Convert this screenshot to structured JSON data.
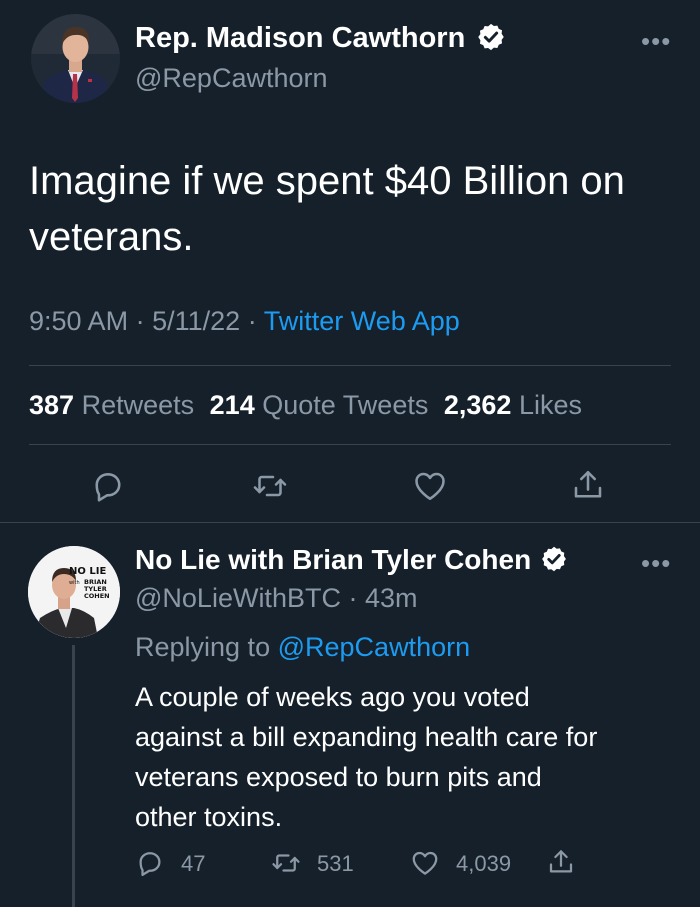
{
  "main_tweet": {
    "author_name": "Rep. Madison Cawthorn",
    "author_handle": "@RepCawthorn",
    "text_line1": "Imagine if we spent $40 Billion on",
    "text_line2": "veterans.",
    "time": "9:50 AM",
    "date": "5/11/22",
    "source": "Twitter Web App",
    "retweets_count": "387",
    "retweets_label": "Retweets",
    "quotes_count": "214",
    "quotes_label": "Quote Tweets",
    "likes_count": "2,362",
    "likes_label": "Likes",
    "more_glyph": "•••"
  },
  "reply_tweet": {
    "author_name": "No Lie with Brian Tyler Cohen",
    "author_handle": "@NoLieWithBTC",
    "separator": "·",
    "age": "43m",
    "replying_prefix": "Replying to",
    "replying_to": "@RepCawthorn",
    "text_lines": [
      "A couple of weeks ago you voted",
      "against a bill expanding health care for",
      "veterans exposed to burn pits and",
      "other toxins."
    ],
    "reply_count": "47",
    "retweet_count": "531",
    "like_count": "4,039",
    "more_glyph": "•••",
    "avatar_logo": {
      "line1": "NO LIE",
      "with": "with",
      "line2": "BRIAN",
      "line3": "TYLER",
      "line4": "COHEN"
    }
  },
  "icons": [
    "verified-badge-icon",
    "reply-icon",
    "retweet-icon",
    "like-icon",
    "share-icon"
  ],
  "colors": {
    "background": "#15202b",
    "link": "#1d9bf0",
    "muted": "#8b98a5",
    "divider": "#38444d"
  }
}
